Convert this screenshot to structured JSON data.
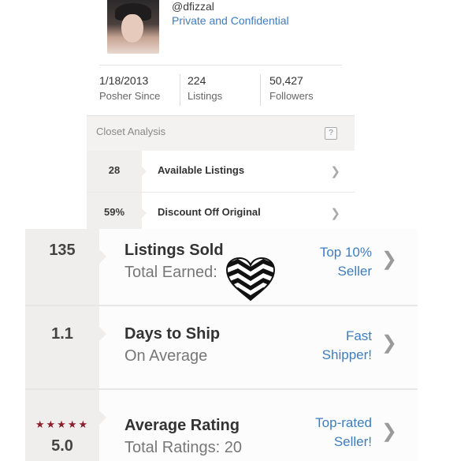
{
  "profile": {
    "username": "@dfizzal",
    "privacy_note": "Private and Confidential",
    "stats": [
      {
        "value": "1/18/2013",
        "label": "Posher Since"
      },
      {
        "value": "224",
        "label": "Listings"
      },
      {
        "value": "50,427",
        "label": "Followers"
      }
    ]
  },
  "closet_analysis": {
    "title": "Closet Analysis",
    "help": "?",
    "rows": [
      {
        "num": "28",
        "label": "Available Listings"
      },
      {
        "num": "59%",
        "label": "Discount Off Original"
      }
    ]
  },
  "metrics": [
    {
      "num": "135",
      "main": "Listings Sold",
      "sub": "Total Earned:",
      "badge_line1": "Top 10%",
      "badge_line2": "Seller"
    },
    {
      "num": "1.1",
      "main": "Days to Ship",
      "sub": "On Average",
      "badge_line1": "Fast",
      "badge_line2": "Shipper!"
    },
    {
      "stars": "★★★★★",
      "num": "5.0",
      "main": "Average Rating",
      "sub": "Total Ratings: 20",
      "badge_line1": "Top-rated",
      "badge_line2": "Seller!"
    }
  ],
  "colors": {
    "link": "#3f7dbd",
    "star": "#8b1d2c"
  }
}
